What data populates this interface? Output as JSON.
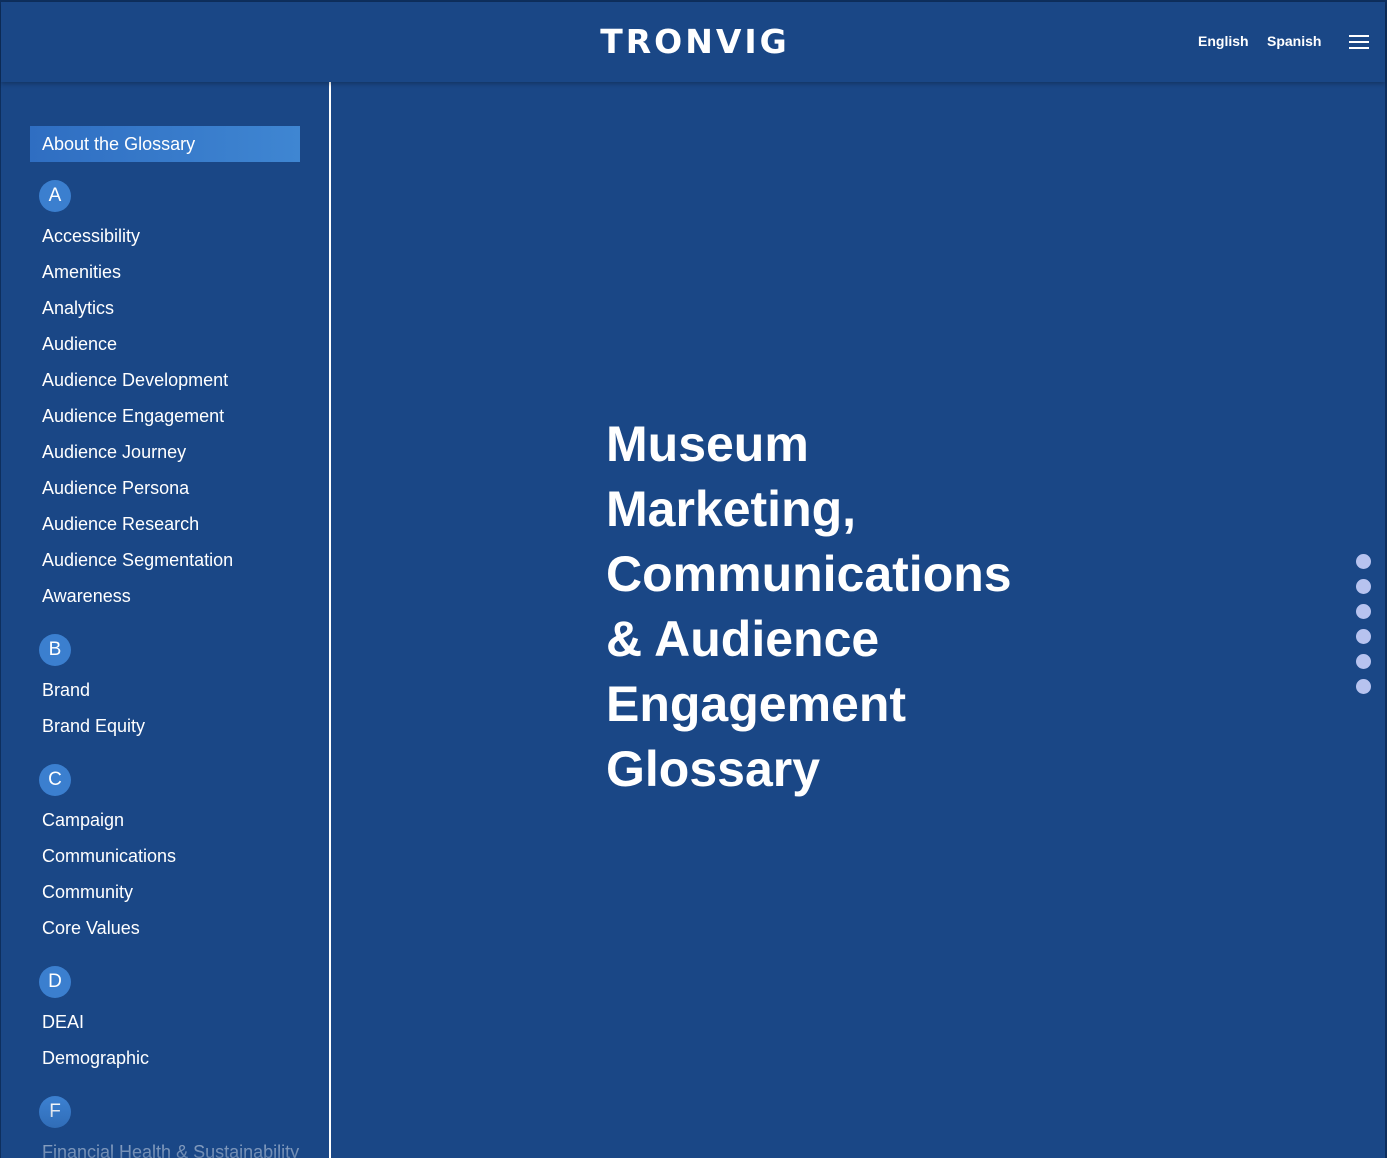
{
  "header": {
    "logo": "TRONVIG",
    "languages": [
      "English",
      "Spanish"
    ]
  },
  "sidebar": {
    "about_label": "About the Glossary",
    "groups": [
      {
        "letter": "A",
        "items": [
          "Accessibility",
          "Amenities",
          "Analytics",
          "Audience",
          "Audience Development",
          "Audience Engagement",
          "Audience Journey",
          "Audience Persona",
          "Audience Research",
          "Audience Segmentation",
          "Awareness"
        ]
      },
      {
        "letter": "B",
        "items": [
          "Brand",
          "Brand Equity"
        ]
      },
      {
        "letter": "C",
        "items": [
          "Campaign",
          "Communications",
          "Community",
          "Core Values"
        ]
      },
      {
        "letter": "D",
        "items": [
          "DEAI",
          "Demographic"
        ]
      },
      {
        "letter": "F",
        "items": [
          "Financial Health & Sustainability"
        ]
      }
    ]
  },
  "hero": {
    "title": "Museum Marketing, Communications & Audience Engagement Glossary"
  },
  "pager": {
    "count": 6
  },
  "colors": {
    "background": "#1a4786",
    "accent": "#3b7fcf",
    "dot": "#b7c3ef"
  }
}
